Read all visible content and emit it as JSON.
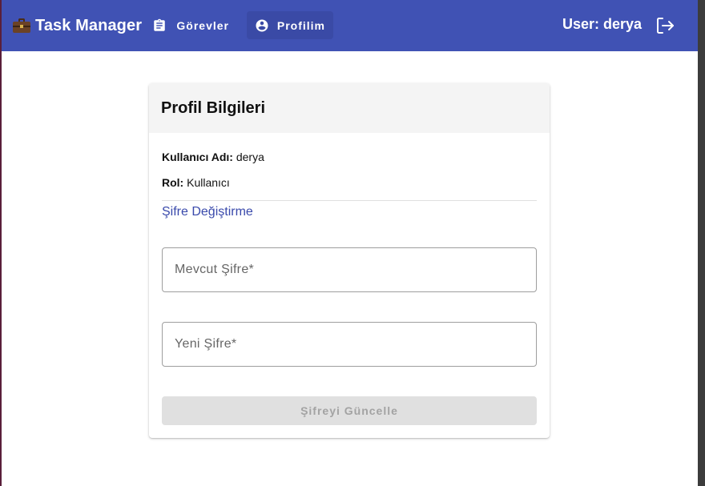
{
  "appbar": {
    "title": "Task Manager",
    "brand_icon": "briefcase-icon",
    "nav": [
      {
        "label": "Görevler",
        "icon": "clipboard-icon",
        "active": false
      },
      {
        "label": "Profilim",
        "icon": "account-circle-icon",
        "active": true
      }
    ],
    "user_label": "User: derya",
    "logout_icon": "logout-icon",
    "background": "#4052b4"
  },
  "profile": {
    "title": "Profil Bilgileri",
    "username_key": "Kullanıcı Adı:",
    "username_value": "derya",
    "role_key": "Rol:",
    "role_value": "Kullanıcı"
  },
  "password_form": {
    "section_title": "Şifre Değiştirme",
    "current_password": {
      "placeholder": "Mevcut Şifre*",
      "value": ""
    },
    "new_password": {
      "placeholder": "Yeni Şifre*",
      "value": ""
    },
    "submit_label": "Şifreyi Güncelle",
    "submit_disabled": true
  },
  "colors": {
    "accent": "#3949ab",
    "disabled_button": "#e0e0e0"
  }
}
